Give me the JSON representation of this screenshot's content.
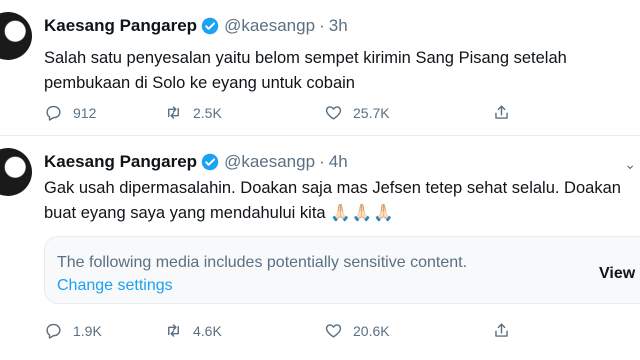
{
  "tweets": [
    {
      "name": "Kaesang Pangarep",
      "handle": "@kaesangp",
      "separator": "·",
      "time": "3h",
      "lines": [
        "Salah satu penyesalan yaitu belom sempet kirimin Sang Pisang setelah",
        "pembukaan di Solo ke eyang untuk cobain"
      ],
      "replies": "912",
      "retweets": "2.5K",
      "likes": "25.7K"
    },
    {
      "name": "Kaesang Pangarep",
      "handle": "@kaesangp",
      "separator": "·",
      "time": "4h",
      "lines": [
        "Gak usah dipermasalahin. Doakan saja mas Jefsen tetep sehat selalu. Doakan",
        "buat eyang saya yang mendahului kita"
      ],
      "emoji": "🙏🏻🙏🏻🙏🏻",
      "media_warning": {
        "text": "The following media includes potentially sensitive content.",
        "link": "Change settings",
        "button": "View"
      },
      "replies": "1.9K",
      "retweets": "4.6K",
      "likes": "20.6K"
    }
  ],
  "colors": {
    "verified": "#1da1f2",
    "link": "#1da1f2",
    "secondary_text": "#5b7083"
  },
  "icons": [
    "verified-badge-icon",
    "reply-icon",
    "retweet-icon",
    "like-icon",
    "share-icon",
    "caret-down-icon"
  ]
}
